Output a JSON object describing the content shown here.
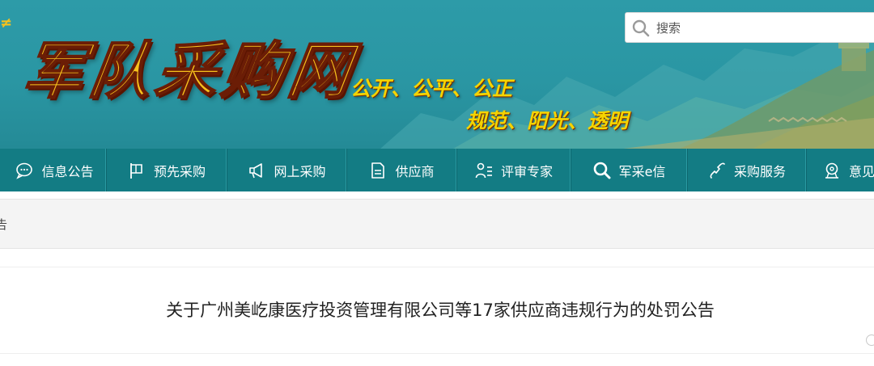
{
  "banner": {
    "logo_text": "军队采购网",
    "slogan_line1": "公开、公平、公正",
    "slogan_line2": "规范、阳光、透明"
  },
  "search": {
    "placeholder": "搜索",
    "icon": "search-icon"
  },
  "nav": {
    "items": [
      {
        "label": "信息公告",
        "icon": "chat-bubble-icon"
      },
      {
        "label": "预先采购",
        "icon": "flag-icon"
      },
      {
        "label": "网上采购",
        "icon": "megaphone-icon"
      },
      {
        "label": "供应商",
        "icon": "document-icon"
      },
      {
        "label": "评审专家",
        "icon": "user-list-icon"
      },
      {
        "label": "军采e信",
        "icon": "search-icon"
      },
      {
        "label": "采购服务",
        "icon": "phone-icon"
      },
      {
        "label": "意见",
        "icon": "feedback-icon"
      }
    ]
  },
  "breadcrumb": {
    "current": "告"
  },
  "article": {
    "title": "关于广州美屹康医疗投资管理有限公司等17家供应商违规行为的处罚公告"
  },
  "colors": {
    "banner_bg": "#2a96a3",
    "nav_bg": "#137c84",
    "logo_gold": "#f7c21c",
    "slogan_yellow": "#f5d400"
  }
}
